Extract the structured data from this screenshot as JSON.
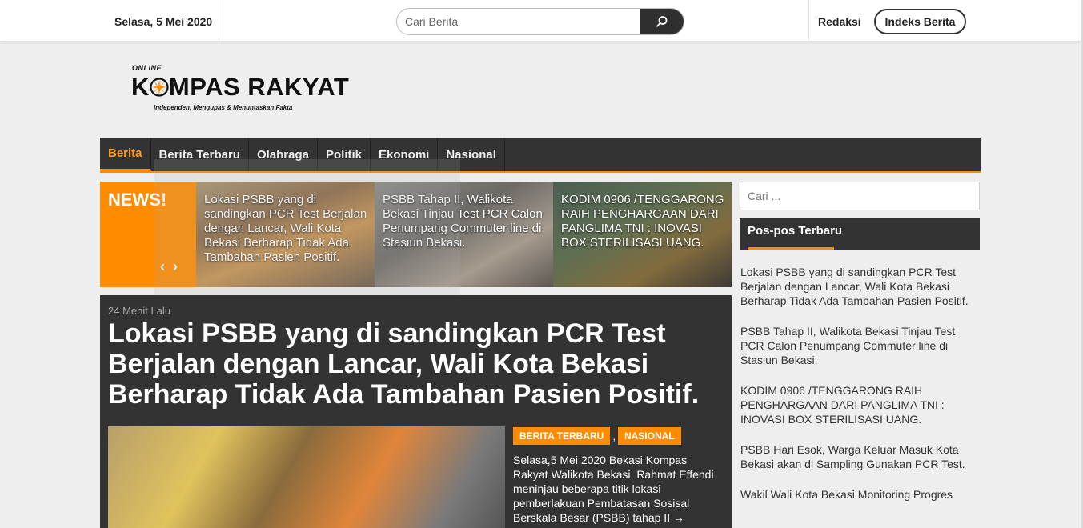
{
  "topbar": {
    "date": "Selasa, 5 Mei 2020",
    "search_placeholder": "Cari Berita",
    "redaksi": "Redaksi",
    "indeks": "Indeks Berita"
  },
  "logo": {
    "online": "ONLINE",
    "brand_k": "K",
    "brand_rest": "MPAS RAKYAT",
    "tagline": "Independen, Mengupas & Menuntaskan Fakta"
  },
  "nav": [
    "Berita",
    "Berita Terbaru",
    "Olahraga",
    "Politik",
    "Ekonomi",
    "Nasional"
  ],
  "ticker": {
    "label": "NEWS!",
    "prev": "‹",
    "next": "›",
    "slides": [
      "Lokasi PSBB yang di sandingkan PCR Test Berjalan dengan Lancar, Wali Kota Bekasi Berharap Tidak Ada Tambahan Pasien Positif.",
      "PSBB Tahap II, Walikota Bekasi Tinjau Test PCR Calon Penumpang Commuter line di Stasiun Bekasi.",
      "KODIM 0906 /TENGGARONG RAIH PENGHARGAAN DARI PANGLIMA TNI : INOVASI BOX STERILISASI UANG."
    ]
  },
  "article": {
    "time": "24 Menit Lalu",
    "headline": "Lokasi PSBB yang di sandingkan PCR Test Berjalan dengan Lancar, Wali Kota Bekasi Berharap Tidak Ada Tambahan Pasien Positif.",
    "tags": [
      "BERITA TERBARU",
      "NASIONAL"
    ],
    "tag_sep": ",",
    "excerpt": "Selasa,5 Mei 2020 Bekasi Kompas Rakyat Walikota Bekasi, Rahmat Effendi meninjau beberapa titik lokasi pemberlakuan Pembatasan Sosisal Berskala Besar (PSBB) tahap II",
    "more": "→"
  },
  "sidebar": {
    "search_placeholder": "Cari ...",
    "heading": "Pos-pos Terbaru",
    "posts": [
      "Lokasi PSBB yang di sandingkan PCR Test Berjalan dengan Lancar, Wali Kota Bekasi Berharap Tidak Ada Tambahan Pasien Positif.",
      "PSBB Tahap II, Walikota Bekasi Tinjau Test PCR Calon Penumpang Commuter line di Stasiun Bekasi.",
      "KODIM 0906 /TENGGARONG RAIH PENGHARGAAN DARI PANGLIMA TNI : INOVASI BOX STERILISASI UANG.",
      "PSBB Hari Esok, Warga Keluar Masuk Kota Bekasi akan di Sampling Gunakan PCR Test.",
      "Wakil Wali Kota Bekasi Monitoring Progres"
    ]
  },
  "colors": {
    "accent": "#ff8c00",
    "dark": "#333333",
    "background": "#eeeeee"
  },
  "icons": {
    "search": "search-icon",
    "logo_o": "compass-sun-icon"
  }
}
